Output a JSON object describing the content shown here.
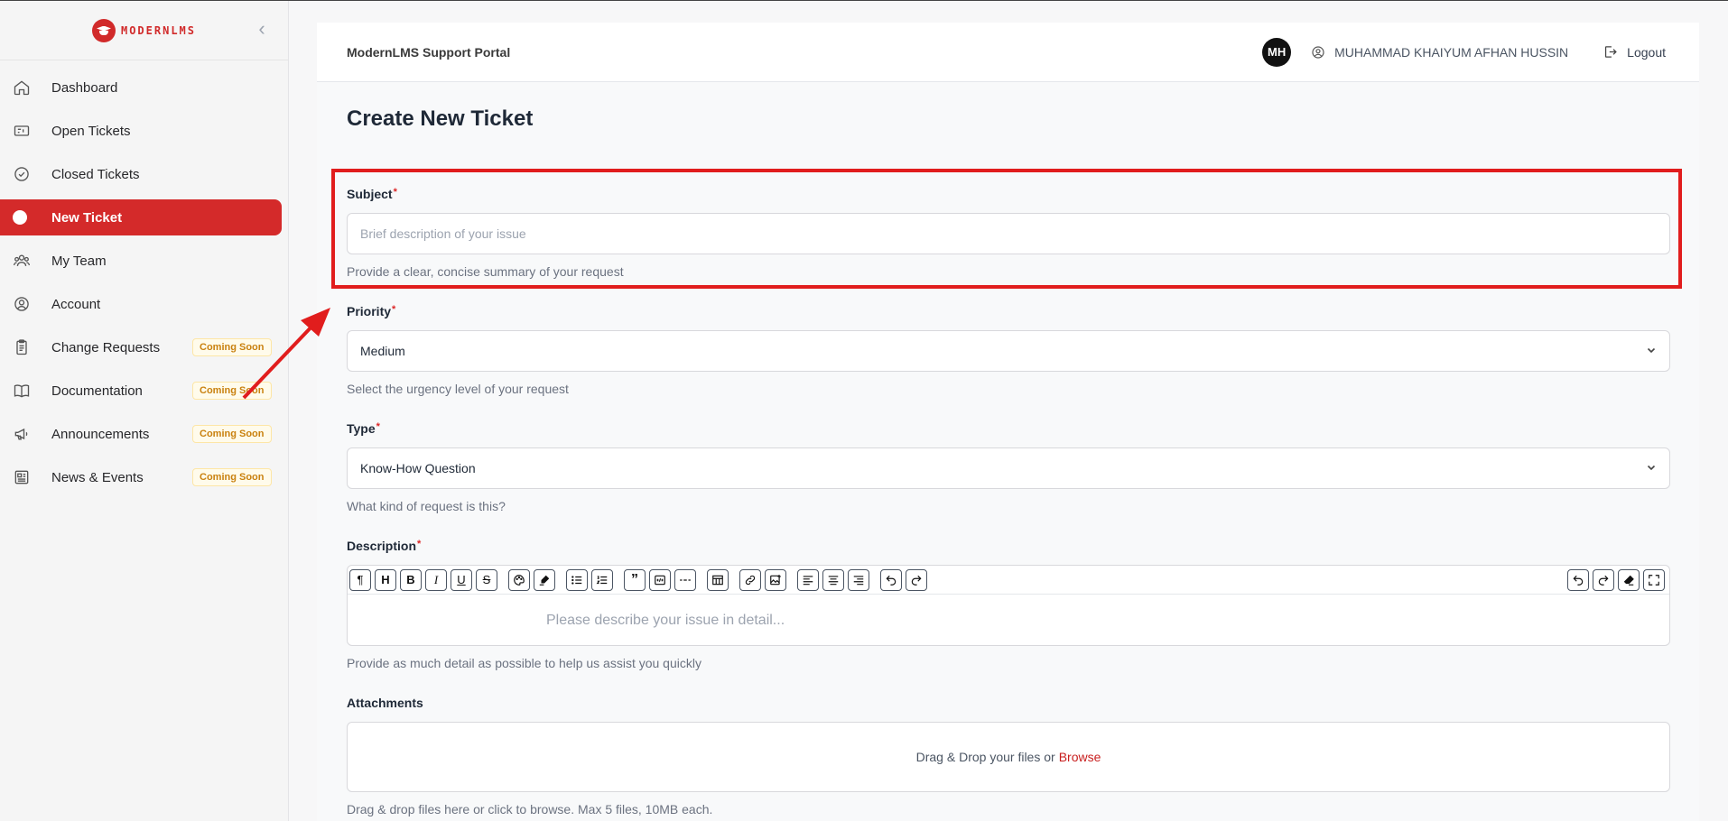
{
  "brand": {
    "name": "MODERNLMS"
  },
  "sidebar": {
    "items": [
      {
        "label": "Dashboard",
        "icon": "home-icon"
      },
      {
        "label": "Open Tickets",
        "icon": "ticket-icon"
      },
      {
        "label": "Closed Tickets",
        "icon": "check-circle-icon"
      },
      {
        "label": "New Ticket",
        "icon": "dot-icon",
        "active": true
      },
      {
        "label": "My Team",
        "icon": "team-icon"
      },
      {
        "label": "Account",
        "icon": "user-circle-icon"
      },
      {
        "label": "Change Requests",
        "icon": "clipboard-icon",
        "badge": "Coming Soon"
      },
      {
        "label": "Documentation",
        "icon": "book-icon",
        "badge": "Coming Soon"
      },
      {
        "label": "Announcements",
        "icon": "megaphone-icon",
        "badge": "Coming Soon"
      },
      {
        "label": "News & Events",
        "icon": "newspaper-icon",
        "badge": "Coming Soon"
      }
    ]
  },
  "header": {
    "portal_title": "ModernLMS Support Portal",
    "avatar_initials": "MH",
    "user_name": "MUHAMMAD KHAIYUM AFHAN HUSSIN",
    "logout_label": "Logout"
  },
  "form": {
    "title": "Create New Ticket",
    "subject": {
      "label": "Subject",
      "required_mark": "*",
      "placeholder": "Brief description of your issue",
      "help": "Provide a clear, concise summary of your request"
    },
    "priority": {
      "label": "Priority",
      "required_mark": "*",
      "value": "Medium",
      "help": "Select the urgency level of your request"
    },
    "type": {
      "label": "Type",
      "required_mark": "*",
      "value": "Know-How Question",
      "help": "What kind of request is this?"
    },
    "description": {
      "label": "Description",
      "required_mark": "*",
      "placeholder": "Please describe your issue in detail...",
      "help": "Provide as much detail as possible to help us assist you quickly"
    },
    "attachments": {
      "label": "Attachments",
      "drop_text": "Drag & Drop your files or",
      "browse_label": "Browse",
      "help": "Drag & drop files here or click to browse. Max 5 files, 10MB each."
    }
  },
  "colors": {
    "accent": "#d42a2a",
    "highlight": "#e11d1d",
    "badge_text": "#c9810f"
  }
}
